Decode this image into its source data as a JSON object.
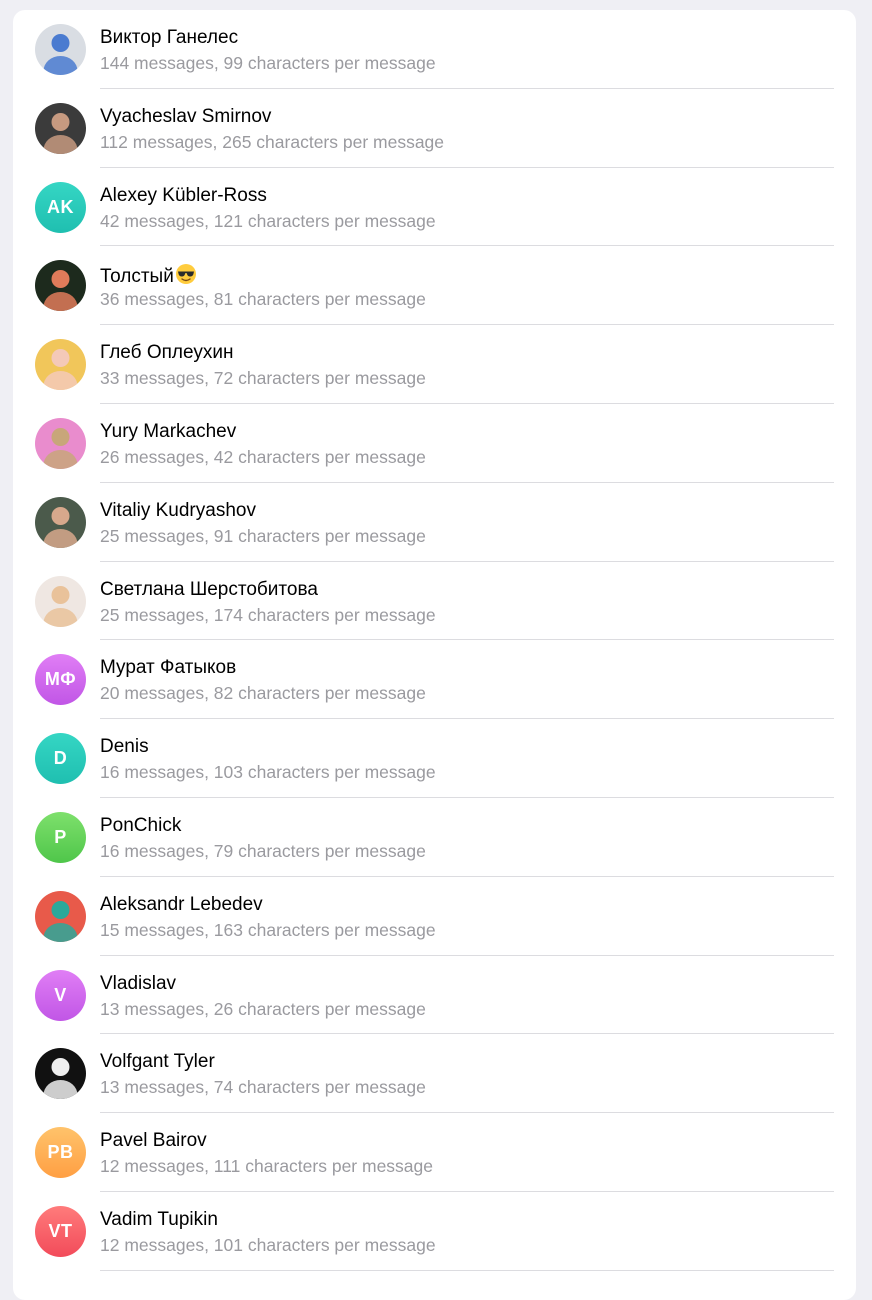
{
  "members": [
    {
      "name": "Виктор Ганелес",
      "stats": "144 messages, 99 characters per message",
      "avatar": {
        "type": "photo",
        "icon": "person-photo-icon",
        "colors": [
          "#d9dde3",
          "#4a7bd0"
        ]
      }
    },
    {
      "name": "Vyacheslav Smirnov",
      "stats": "112 messages, 265 characters per message",
      "avatar": {
        "type": "photo",
        "icon": "person-photo-icon",
        "colors": [
          "#3b3b3b",
          "#c79a80"
        ]
      }
    },
    {
      "name": "Alexey Kübler-Ross",
      "stats": "42 messages, 121 characters per message",
      "avatar": {
        "type": "initials",
        "initials": "AK",
        "colors": [
          "#35d6c4",
          "#1fbfb0"
        ]
      }
    },
    {
      "name": "Толстый",
      "emoji": "😎",
      "stats": "36 messages, 81 characters per message",
      "avatar": {
        "type": "photo",
        "icon": "person-photo-icon",
        "colors": [
          "#1d2a1d",
          "#e07b5a"
        ]
      }
    },
    {
      "name": "Глеб Оплеухин",
      "stats": "33 messages, 72 characters per message",
      "avatar": {
        "type": "photo",
        "icon": "anime-photo-icon",
        "colors": [
          "#f1c65a",
          "#f4c9b8"
        ]
      }
    },
    {
      "name": "Yury Markachev",
      "stats": "26 messages, 42 characters per message",
      "avatar": {
        "type": "photo",
        "icon": "person-photo-icon",
        "colors": [
          "#e98ccd",
          "#c8a67a"
        ]
      }
    },
    {
      "name": "Vitaliy Kudryashov",
      "stats": "25 messages, 91 characters per message",
      "avatar": {
        "type": "photo",
        "icon": "person-photo-icon",
        "colors": [
          "#4b5a4b",
          "#d7a88c"
        ]
      }
    },
    {
      "name": "Светлана Шерстобитова",
      "stats": "25 messages, 174 characters per message",
      "avatar": {
        "type": "photo",
        "icon": "person-photo-icon",
        "colors": [
          "#efe7e2",
          "#e9c29a"
        ]
      }
    },
    {
      "name": "Мурат Фатыков",
      "stats": "20 messages, 82 characters per message",
      "avatar": {
        "type": "initials",
        "initials": "МФ",
        "colors": [
          "#e07ef5",
          "#c156e6"
        ]
      }
    },
    {
      "name": "Denis",
      "stats": "16 messages, 103 characters per message",
      "avatar": {
        "type": "initials",
        "initials": "D",
        "colors": [
          "#35d6c4",
          "#1fbfb0"
        ]
      }
    },
    {
      "name": "PonChick",
      "stats": "16 messages, 79 characters per message",
      "avatar": {
        "type": "initials",
        "initials": "P",
        "colors": [
          "#7ee06c",
          "#4fc64a"
        ]
      }
    },
    {
      "name": "Aleksandr Lebedev",
      "stats": "15 messages, 163 characters per message",
      "avatar": {
        "type": "photo",
        "icon": "person-photo-icon",
        "colors": [
          "#e85a4a",
          "#2ba89a"
        ]
      }
    },
    {
      "name": "Vladislav",
      "stats": "13 messages, 26 characters per message",
      "avatar": {
        "type": "initials",
        "initials": "V",
        "colors": [
          "#e07ef5",
          "#c156e6"
        ]
      }
    },
    {
      "name": "Volfgant Tyler",
      "stats": "13 messages, 74 characters per message",
      "avatar": {
        "type": "photo",
        "icon": "person-photo-icon",
        "colors": [
          "#111111",
          "#eeeeee"
        ]
      }
    },
    {
      "name": "Pavel Bairov",
      "stats": "12 messages, 111 characters per message",
      "avatar": {
        "type": "initials",
        "initials": "PB",
        "colors": [
          "#ffc36b",
          "#ff9f43"
        ]
      }
    },
    {
      "name": "Vadim Tupikin",
      "stats": "12 messages, 101 characters per message",
      "avatar": {
        "type": "initials",
        "initials": "VT",
        "colors": [
          "#ff7b7b",
          "#f24b5a"
        ]
      }
    }
  ]
}
